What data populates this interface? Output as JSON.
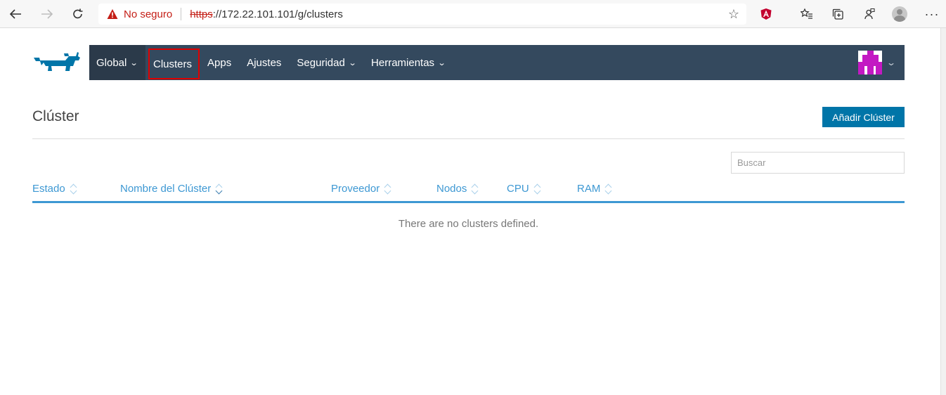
{
  "browser": {
    "security_label": "No seguro",
    "url_scheme": "https",
    "url_rest": "://172.22.101.101/g/clusters",
    "icons": [
      "back-icon",
      "forward-icon",
      "refresh-icon",
      "warning-icon",
      "favorite-star-icon",
      "angular-extension-icon",
      "favorites-icon",
      "collections-icon",
      "feedback-icon",
      "profile-icon",
      "more-icon"
    ]
  },
  "nav": {
    "global_label": "Global",
    "items": [
      {
        "label": "Clusters"
      },
      {
        "label": "Apps"
      },
      {
        "label": "Ajustes"
      },
      {
        "label": "Seguridad"
      },
      {
        "label": "Herramientas"
      }
    ]
  },
  "page": {
    "title": "Clúster",
    "add_button": "Añadir Clúster",
    "search_placeholder": "Buscar"
  },
  "table": {
    "columns": [
      "Estado",
      "Nombre del Clúster",
      "Proveedor",
      "Nodos",
      "CPU",
      "RAM"
    ],
    "empty_message": "There are no clusters defined."
  },
  "colors": {
    "nav_bg": "#34495e",
    "accent": "#0075a8",
    "link": "#3d98d3",
    "highlight": "#e00000"
  }
}
